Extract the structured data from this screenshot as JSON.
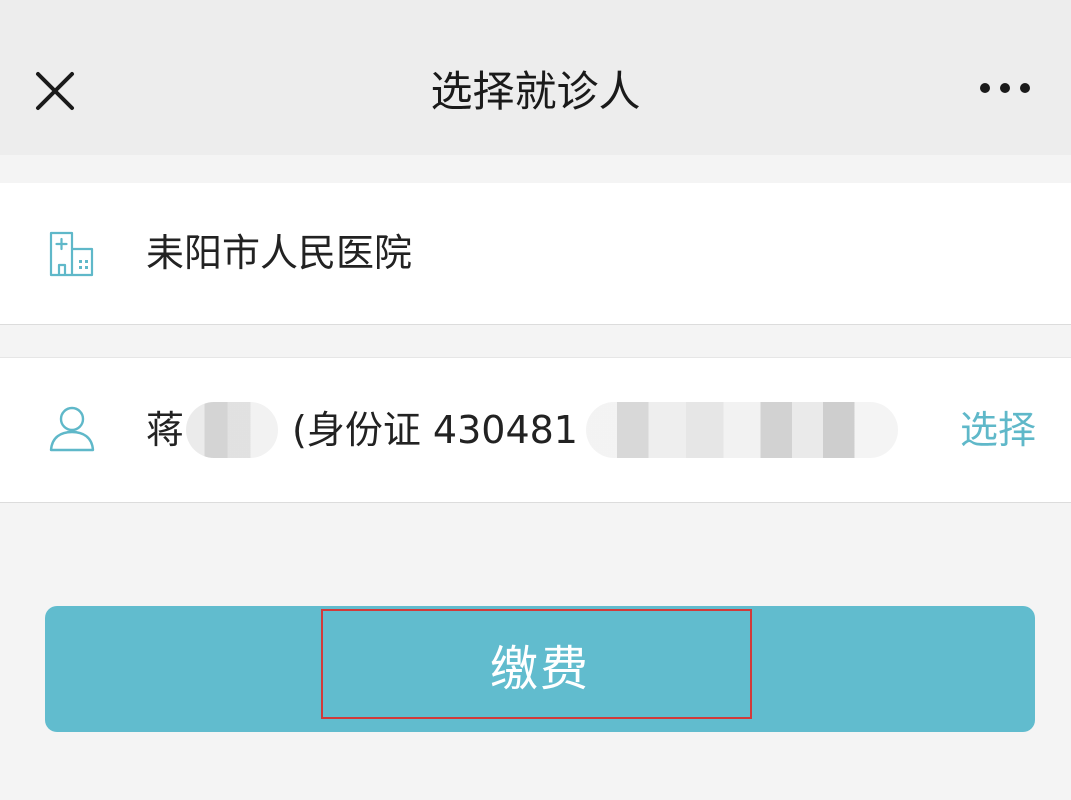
{
  "header": {
    "title": "选择就诊人",
    "close_icon": "close-icon",
    "more_icon": "more-icon"
  },
  "hospital": {
    "icon": "hospital-icon",
    "name": "耒阳市人民医院"
  },
  "patient": {
    "icon": "user-icon",
    "name_prefix": "蒋",
    "id_prefix": "(身份证 430481",
    "select_label": "选择"
  },
  "pay": {
    "label": "缴费"
  },
  "colors": {
    "accent": "#61bcce",
    "link": "#5fb8c9",
    "highlight": "#d23a3a",
    "header_bg": "#ededed"
  }
}
